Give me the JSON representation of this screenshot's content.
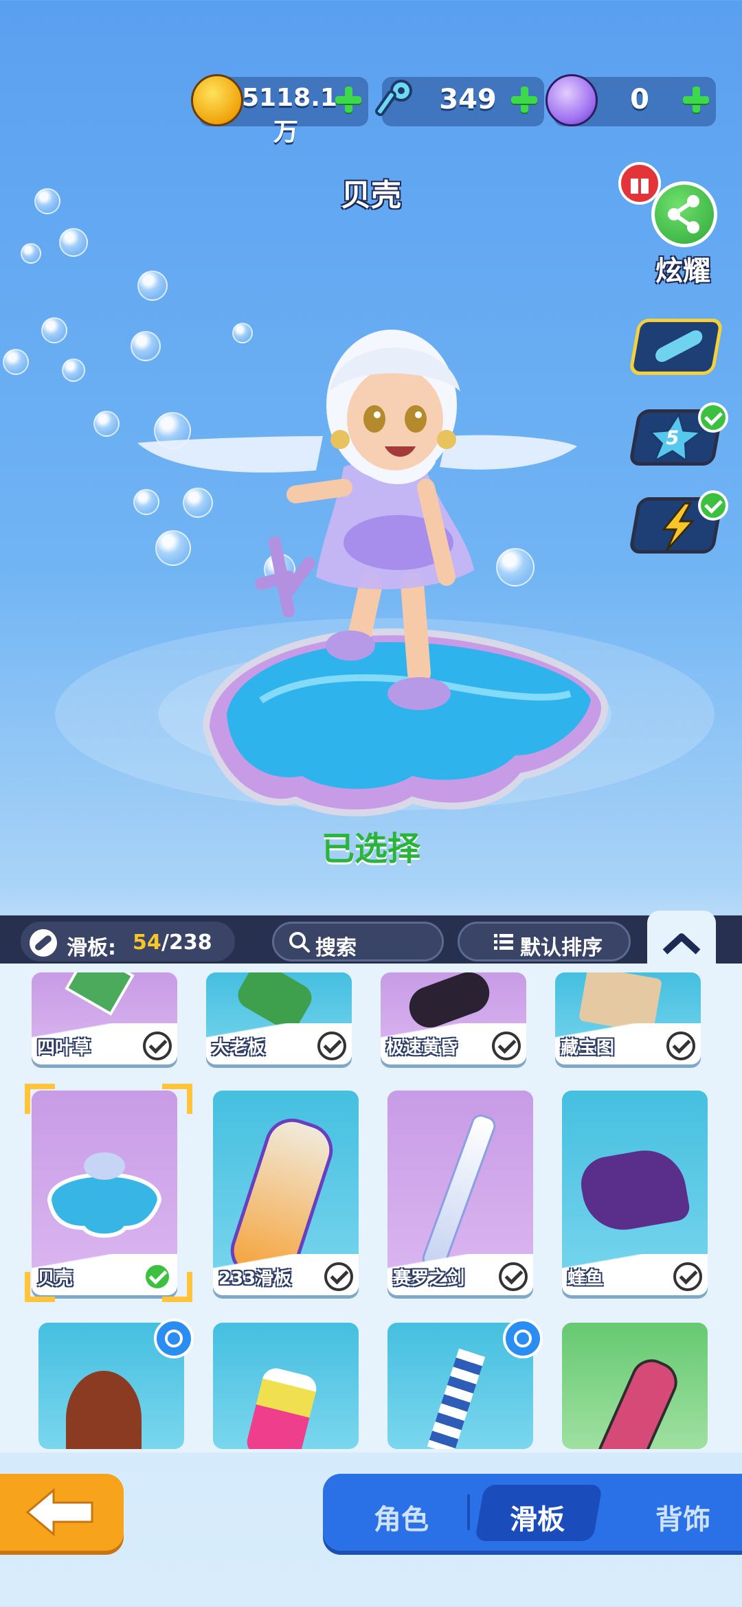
{
  "currencies": [
    {
      "name": "coin-icon",
      "value": "5118.1万",
      "color": "#f5b90f"
    },
    {
      "name": "key-icon",
      "value": "349",
      "color": "#5fd2f0"
    },
    {
      "name": "gem-icon",
      "value": "0",
      "color": "#a77cf0"
    }
  ],
  "item_title": "贝壳",
  "share_label": "炫耀",
  "badge_level": "5",
  "selected_label": "已选择",
  "collection": {
    "label": "滑板:",
    "owned": "54",
    "total": "/238"
  },
  "search_label": "搜索",
  "sort_label": "默认排序",
  "items_row1": [
    {
      "name": "四叶草",
      "owned": true
    },
    {
      "name": "大老板",
      "owned": true
    },
    {
      "name": "极速黄昏",
      "owned": true
    },
    {
      "name": "藏宝图",
      "owned": true
    }
  ],
  "items_row2": [
    {
      "name": "贝壳",
      "owned": true,
      "selected": true
    },
    {
      "name": "233滑板",
      "owned": true
    },
    {
      "name": "赛罗之剑",
      "owned": true
    },
    {
      "name": "蝰鱼",
      "owned": true
    }
  ],
  "items_row3_timers": [
    true,
    false,
    true,
    false
  ],
  "nav": {
    "tab1": "角色",
    "tab2": "滑板",
    "tab3": "背饰",
    "active": "滑板"
  },
  "colors": {
    "accent": "#2a71e8",
    "selected_frame": "#ffc43a",
    "selected_text": "#2bb43c"
  }
}
